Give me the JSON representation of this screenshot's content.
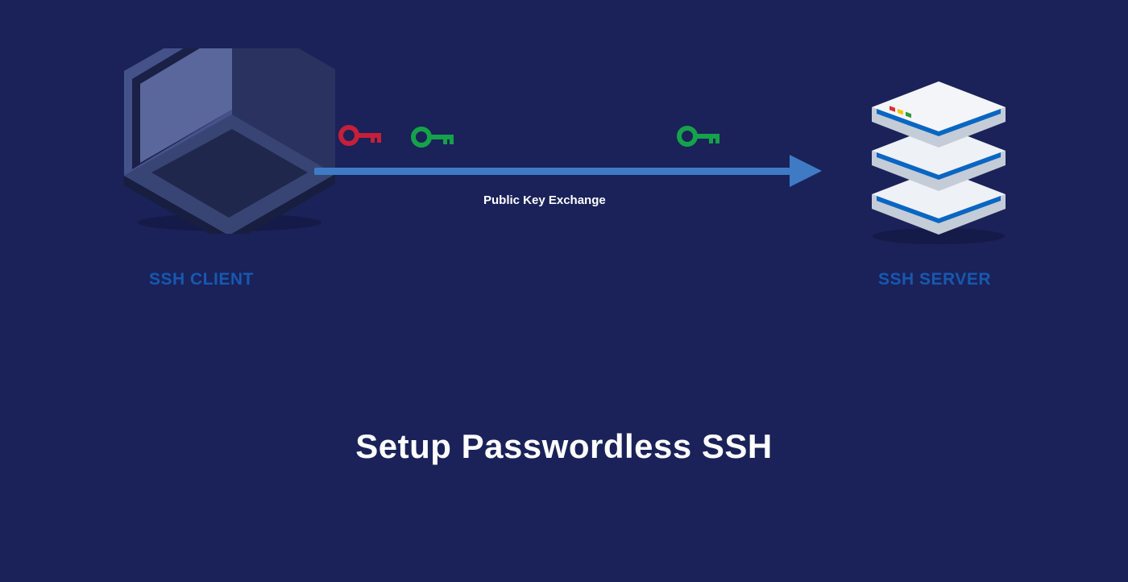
{
  "colors": {
    "bg": "#1a2259",
    "label_blue": "#1858b0",
    "arrow": "#3f7bc4",
    "key_red": "#c61f3a",
    "key_green": "#15a24a",
    "server_body": "#e9edf2",
    "server_stripe": "#0a66c2",
    "laptop_light": "#3d4a7a",
    "laptop_dark": "#2a3460"
  },
  "labels": {
    "client": "SSH CLIENT",
    "server": "SSH SERVER",
    "exchange": "Public Key Exchange"
  },
  "title": "Setup Passwordless SSH",
  "icons": {
    "key_red": "lock-key-icon",
    "key_green_client": "lock-key-icon",
    "key_green_server": "lock-key-icon",
    "laptop": "laptop-icon",
    "server": "server-icon"
  }
}
